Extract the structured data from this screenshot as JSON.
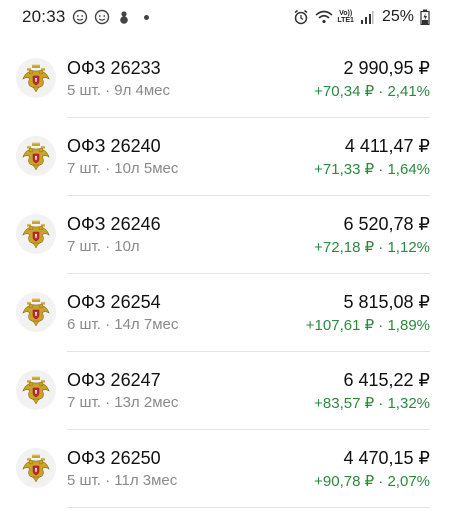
{
  "status_bar": {
    "time": "20:33",
    "battery": "25%",
    "network": "LTE1",
    "volte": "Vo))"
  },
  "currency_symbol": "₽",
  "holdings": [
    {
      "name": "ОФЗ 26233",
      "meta": "5 шт. · 9л 4мес",
      "value": "2 990,95 ₽",
      "change": "+70,34 ₽ · 2,41%"
    },
    {
      "name": "ОФЗ 26240",
      "meta": "7 шт. · 10л 5мес",
      "value": "4 411,47 ₽",
      "change": "+71,33 ₽ · 1,64%"
    },
    {
      "name": "ОФЗ 26246",
      "meta": "7 шт. · 10л",
      "value": "6 520,78 ₽",
      "change": "+72,18 ₽ · 1,12%"
    },
    {
      "name": "ОФЗ 26254",
      "meta": "6 шт. · 14л 7мес",
      "value": "5 815,08 ₽",
      "change": "+107,61 ₽ · 1,89%"
    },
    {
      "name": "ОФЗ 26247",
      "meta": "7 шт. · 13л 2мес",
      "value": "6 415,22 ₽",
      "change": "+83,57 ₽ · 1,32%"
    },
    {
      "name": "ОФЗ 26250",
      "meta": "5 шт. · 11л 3мес",
      "value": "4 470,15 ₽",
      "change": "+90,78 ₽ · 2,07%"
    }
  ],
  "colors": {
    "positive": "#2a8a3e",
    "meta_text": "#8a8a8a",
    "divider": "#e4e4e4"
  },
  "icons": {
    "holding_logo": "russian-coat-of-arms-icon"
  }
}
